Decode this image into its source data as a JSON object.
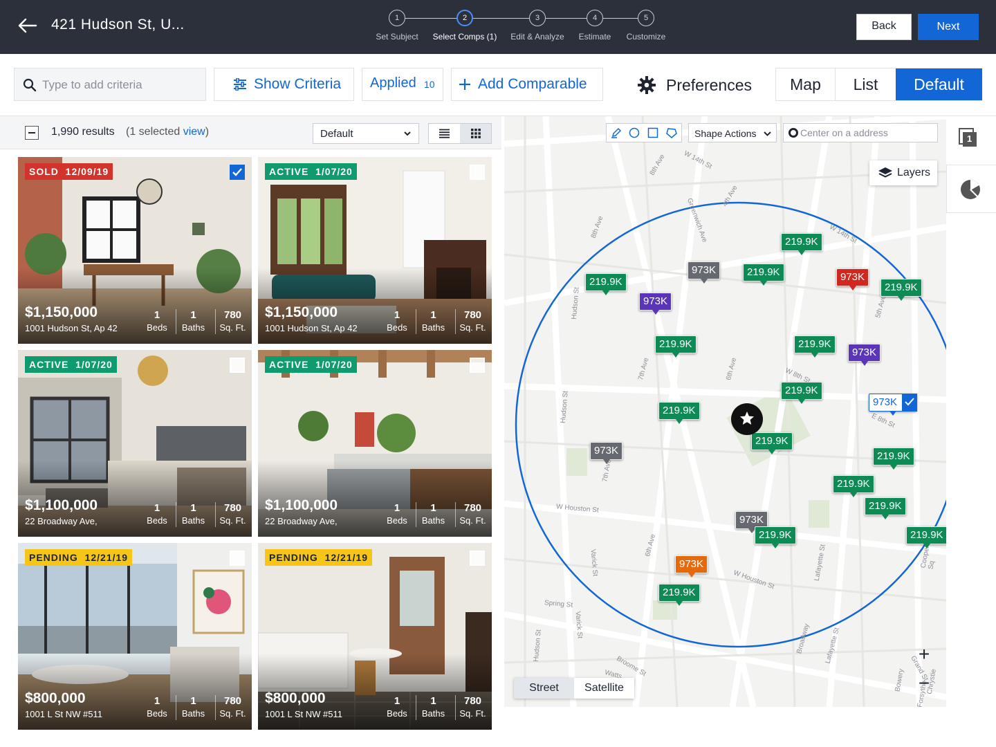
{
  "header": {
    "address": "421 Hudson St,  U...",
    "steps": [
      {
        "num": "1",
        "label": "Set Subject"
      },
      {
        "num": "2",
        "label": "Select Comps (1)"
      },
      {
        "num": "3",
        "label": "Edit & Analyze"
      },
      {
        "num": "4",
        "label": "Estimate"
      },
      {
        "num": "5",
        "label": "Customize"
      }
    ],
    "active_step": 2,
    "back_label": "Back",
    "next_label": "Next"
  },
  "toolbar": {
    "search_placeholder": "Type to add criteria",
    "show_criteria": "Show Criteria",
    "applied_label": "Applied",
    "applied_count": "10",
    "add_comparable": "Add Comparable",
    "preferences": "Preferences",
    "views": [
      "Map",
      "List",
      "Default"
    ],
    "active_view": "Default"
  },
  "results": {
    "count": "1,990 results",
    "selected_prefix": "(1 selected ",
    "selected_link": "view",
    "selected_suffix": ")",
    "sort_value": "Default"
  },
  "cards": [
    {
      "status": "SOLD",
      "date": "12/09/19",
      "status_kind": "sold",
      "checked": true,
      "price": "$1,150,000",
      "address": "1001 Hudson St, Ap 42",
      "beds": "1",
      "baths": "1",
      "sqft": "780"
    },
    {
      "status": "ACTIVE",
      "date": "1/07/20",
      "status_kind": "active",
      "checked": false,
      "price": "$1,150,000",
      "address": "1001 Hudson St, Ap 42",
      "beds": "1",
      "baths": "1",
      "sqft": "780"
    },
    {
      "status": "ACTIVE",
      "date": "1/07/20",
      "status_kind": "active",
      "checked": false,
      "price": "$1,100,000",
      "address": "22 Broadway Ave,",
      "beds": "1",
      "baths": "1",
      "sqft": "780"
    },
    {
      "status": "ACTIVE",
      "date": "1/07/20",
      "status_kind": "active",
      "checked": false,
      "price": "$1,100,000",
      "address": "22 Broadway Ave,",
      "beds": "1",
      "baths": "1",
      "sqft": "780"
    },
    {
      "status": "PENDING",
      "date": "12/21/19",
      "status_kind": "pending",
      "checked": false,
      "price": "$800,000",
      "address": "1001 L St NW #511",
      "beds": "1",
      "baths": "1",
      "sqft": "780"
    },
    {
      "status": "PENDING",
      "date": "12/21/19",
      "status_kind": "pending",
      "checked": false,
      "price": "$800,000",
      "address": "1001 L St NW #511",
      "beds": "1",
      "baths": "1",
      "sqft": "780"
    }
  ],
  "stat_labels": {
    "beds": "Beds",
    "baths": "Baths",
    "sqft": "Sq. Ft."
  },
  "map": {
    "shape_actions": "Shape Actions",
    "center_placeholder": "Center on a address",
    "layers": "Layers",
    "map_types": [
      "Street",
      "Satellite"
    ],
    "active_map_type": "Street",
    "zoom_in": "+",
    "zoom_out": "−",
    "rail_badge": "1",
    "streets": [
      "W 14th St",
      "8th Ave",
      "Greenwich Ave",
      "4th Ave",
      "8th Ave",
      "W 14th St",
      "Hudson St",
      "7th Ave",
      "6th Ave",
      "W 8th St",
      "E 8th St",
      "5th Ave",
      "Hudson St",
      "W Houston St",
      "6th Ave",
      "Varick St",
      "Spring St",
      "Varick St",
      "W Houston St",
      "Lafayette St",
      "Broadway",
      "Broome St",
      "Hudson St",
      "Lafayette St",
      "Watts",
      "Bowery",
      "Forsythe",
      "Chrystie",
      "Grand St",
      "Cooper Sq",
      "7th Ave"
    ],
    "markers": [
      {
        "label": "219.9K",
        "kind": "g"
      },
      {
        "label": "219.9K",
        "kind": "g"
      },
      {
        "label": "973K",
        "kind": "gr"
      },
      {
        "label": "219.9K",
        "kind": "g"
      },
      {
        "label": "973K",
        "kind": "r"
      },
      {
        "label": "219.9K",
        "kind": "g"
      },
      {
        "label": "973K",
        "kind": "p"
      },
      {
        "label": "219.9K",
        "kind": "g"
      },
      {
        "label": "219.9K",
        "kind": "g"
      },
      {
        "label": "973K",
        "kind": "p"
      },
      {
        "label": "219.9K",
        "kind": "g"
      },
      {
        "label": "973K",
        "kind": "sel"
      },
      {
        "label": "219.9K",
        "kind": "g"
      },
      {
        "label": "219.9K",
        "kind": "g"
      },
      {
        "label": "973K",
        "kind": "gr"
      },
      {
        "label": "219.9K",
        "kind": "g"
      },
      {
        "label": "219.9K",
        "kind": "g"
      },
      {
        "label": "219.9K",
        "kind": "g"
      },
      {
        "label": "973K",
        "kind": "gr"
      },
      {
        "label": "219.9K",
        "kind": "g"
      },
      {
        "label": "219.9K",
        "kind": "g"
      },
      {
        "label": "973K",
        "kind": "o"
      },
      {
        "label": "219.9K",
        "kind": "g"
      }
    ]
  }
}
